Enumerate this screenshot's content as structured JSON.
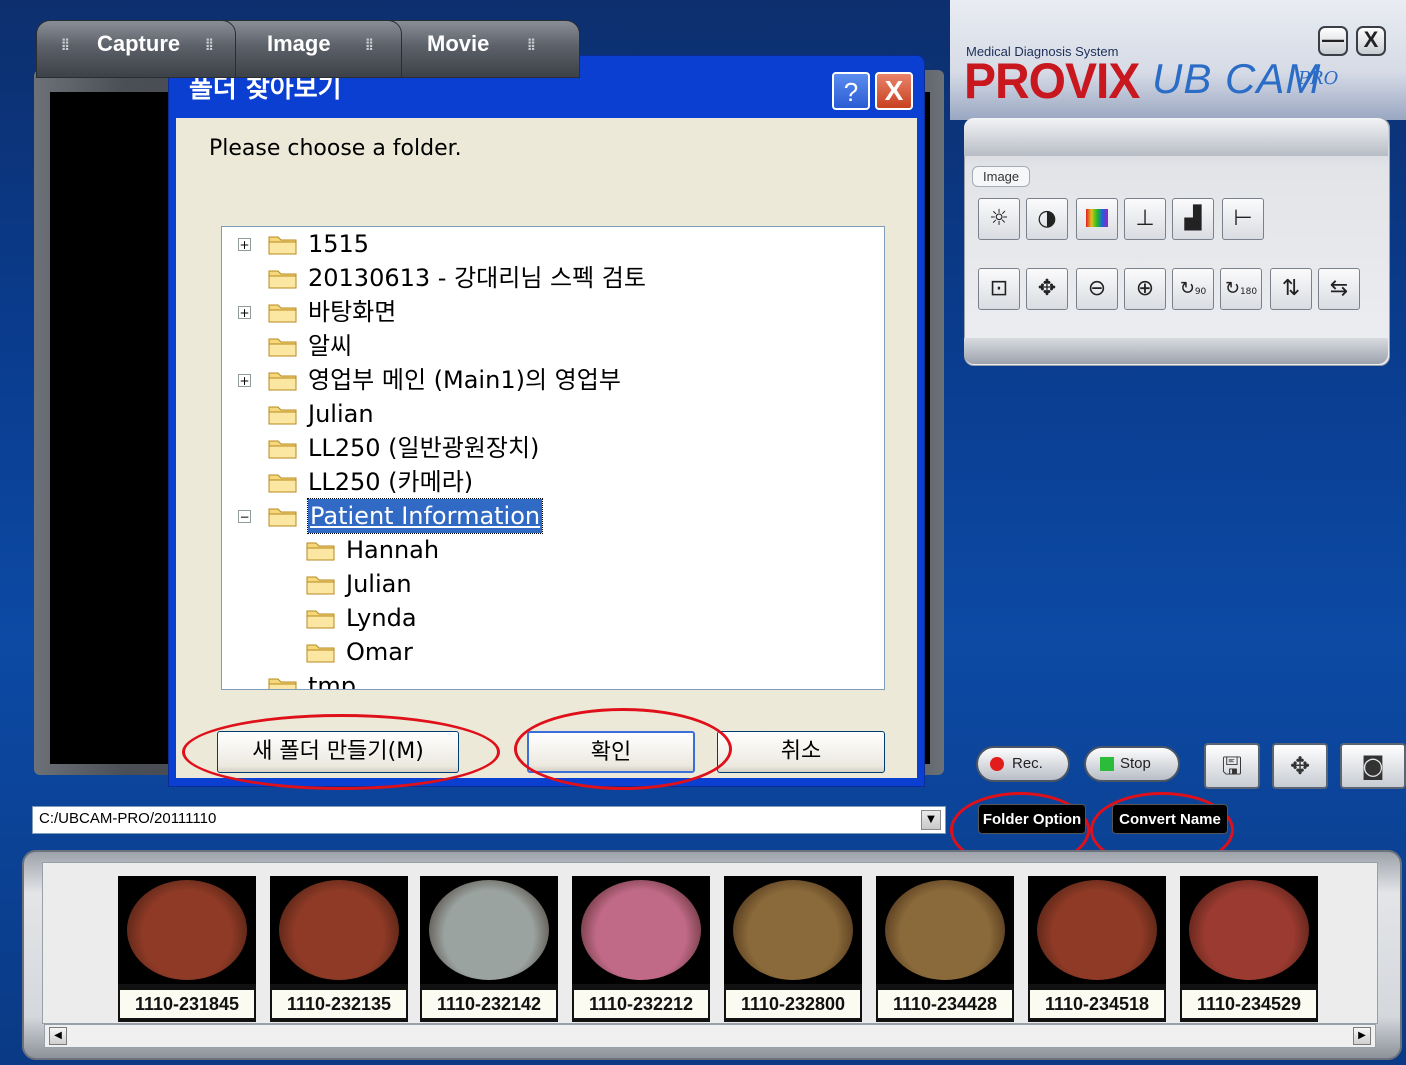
{
  "tabs": [
    {
      "label": "Capture"
    },
    {
      "label": "Image"
    },
    {
      "label": "Movie"
    }
  ],
  "logo": {
    "subtitle": "Medical Diagnosis System",
    "brand": "PROVIX",
    "product": "UB CAM",
    "edition": "PRO",
    "brand_color": "#c8171e",
    "product_color": "#2b6cc6"
  },
  "window_controls": {
    "minimize": "—",
    "close": "X"
  },
  "tools_panel": {
    "section_label": "Image",
    "row1_icons": [
      "brightness-icon",
      "contrast-icon",
      "color-bars-icon",
      "level-icon",
      "histogram-icon",
      "line-icon"
    ],
    "row2_icons": [
      "zoom-area-icon",
      "move-icon",
      "zoom-out-icon",
      "zoom-in-icon",
      "rotate-90-icon",
      "rotate-180-icon",
      "flip-icon",
      "mirror-icon"
    ],
    "rotate_90_label": "90",
    "rotate_180_label": "180"
  },
  "dialog": {
    "title": "폴더 찾아보기",
    "help": "?",
    "close": "X",
    "prompt": "Please choose a folder.",
    "tree": [
      {
        "label": "1515",
        "expander": "+"
      },
      {
        "label": "20130613 - 강대리님 스펙 검토",
        "expander": ""
      },
      {
        "label": "바탕화면",
        "expander": "+"
      },
      {
        "label": "알씨",
        "expander": ""
      },
      {
        "label": "영업부 메인 (Main1)의 영업부",
        "expander": "+"
      },
      {
        "label": "Julian",
        "expander": ""
      },
      {
        "label": "LL250 (일반광원장치)",
        "expander": ""
      },
      {
        "label": "LL250 (카메라)",
        "expander": ""
      },
      {
        "label": "Patient Information",
        "expander": "−",
        "selected": true
      },
      {
        "label": "Hannah",
        "child": true
      },
      {
        "label": "Julian",
        "child": true
      },
      {
        "label": "Lynda",
        "child": true
      },
      {
        "label": "Omar",
        "child": true
      },
      {
        "label": "tmp",
        "expander": ""
      }
    ],
    "buttons": {
      "new_folder": "새 폴더 만들기(M)",
      "ok": "확인",
      "cancel": "취소"
    }
  },
  "controls": {
    "rec": "Rec.",
    "stop": "Stop",
    "folder_option": "Folder Option",
    "convert_name": "Convert Name",
    "path": "C:/UBCAM-PRO/20111110"
  },
  "thumbnails": [
    {
      "caption": "1110-231845",
      "tint": "#8e3a26"
    },
    {
      "caption": "1110-232135",
      "tint": "#8e3a26"
    },
    {
      "caption": "1110-232142",
      "tint": "#9aa3a0"
    },
    {
      "caption": "1110-232212",
      "tint": "#c16a88"
    },
    {
      "caption": "1110-232800",
      "tint": "#8a6a3a"
    },
    {
      "caption": "1110-234428",
      "tint": "#8a6a3a"
    },
    {
      "caption": "1110-234518",
      "tint": "#8e3a26"
    },
    {
      "caption": "1110-234529",
      "tint": "#9a3a30"
    }
  ]
}
